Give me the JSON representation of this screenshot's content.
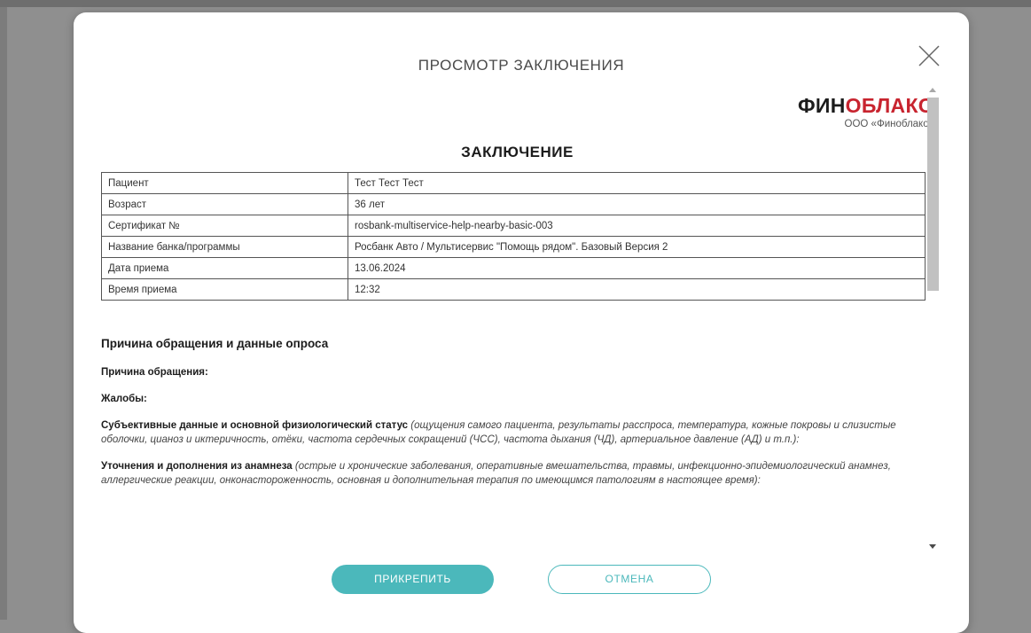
{
  "modal": {
    "title": "ПРОСМОТР ЗАКЛЮЧЕНИЯ"
  },
  "brand": {
    "logo_part1": "ФИН",
    "logo_part2": "ОБЛАКО",
    "subtitle": "ООО «Финоблако»",
    "colors": {
      "dark": "#1c1c1c",
      "red": "#c8242f"
    }
  },
  "document": {
    "title": "ЗАКЛЮЧЕНИЕ",
    "rows": [
      {
        "label": "Пациент",
        "value": "Тест Тест Тест"
      },
      {
        "label": "Возраст",
        "value": "36 лет"
      },
      {
        "label": "Сертификат №",
        "value": "rosbank-multiservice-help-nearby-basic-003"
      },
      {
        "label": "Название банка/программы",
        "value": "Росбанк Авто / Мультисервис \"Помощь рядом\". Базовый Версия 2"
      },
      {
        "label": "Дата приема",
        "value": "13.06.2024"
      },
      {
        "label": "Время приема",
        "value": "12:32"
      }
    ],
    "section_heading": "Причина обращения и данные опроса",
    "reason_label": "Причина обращения:",
    "complaints_label": "Жалобы:",
    "subjective_label": "Субъективные данные и основной физиологический статус",
    "subjective_hint": "(ощущения самого пациента, результаты расспроса, температура, кожные покровы и слизистые оболочки, цианоз и иктеричность, отёки, частота сердечных сокращений (ЧСС), частота дыхания (ЧД), артериальное давление (АД) и т.п.):",
    "anamnesis_label": "Уточнения и дополнения из анамнеза",
    "anamnesis_hint": "(острые и хронические заболевания, оперативные вмешательства, травмы, инфекционно-эпидемиологический анамнез, аллергические реакции, онконастороженность, основная и дополнительная терапия по имеющимся патологиям в настоящее время):"
  },
  "buttons": {
    "attach_label": "ПРИКРЕПИТЬ",
    "cancel_label": "ОТМЕНА"
  },
  "colors": {
    "accent": "#4bb8bb",
    "overlay": "#8f8f8f"
  }
}
